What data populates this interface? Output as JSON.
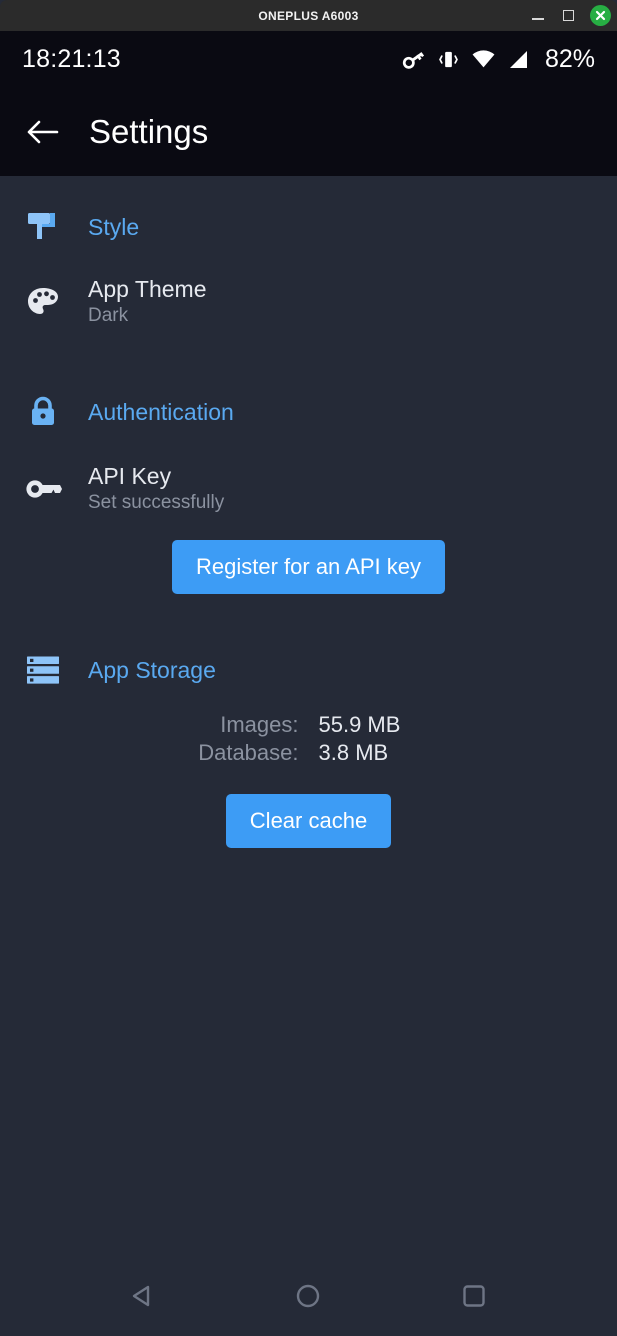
{
  "window": {
    "title": "ONEPLUS A6003",
    "controls": {
      "minimize": "minimize-window",
      "maximize": "maximize-window",
      "close": "close-window"
    }
  },
  "status_bar": {
    "time": "18:21:13",
    "battery": "82%",
    "icons": [
      "vpn-key-icon",
      "vibrate-icon",
      "wifi-icon",
      "cellular-signal-icon"
    ]
  },
  "app_bar": {
    "back_icon": "arrow-left-icon",
    "title": "Settings"
  },
  "sections": [
    {
      "id": "style",
      "icon": "paint-roller-icon",
      "title": "Style",
      "rows": [
        {
          "id": "app-theme",
          "icon": "palette-icon",
          "title": "App Theme",
          "subtitle": "Dark"
        }
      ]
    },
    {
      "id": "authentication",
      "icon": "lock-icon",
      "title": "Authentication",
      "rows": [
        {
          "id": "api-key",
          "icon": "key-icon",
          "title": "API Key",
          "subtitle": "Set successfully"
        }
      ],
      "button": "Register for an API key"
    },
    {
      "id": "app-storage",
      "icon": "storage-icon",
      "title": "App Storage",
      "storage": [
        {
          "label": "Images:",
          "value": "55.9 MB"
        },
        {
          "label": "Database:",
          "value": "3.8 MB"
        }
      ],
      "button": "Clear cache"
    }
  ],
  "nav_bar": {
    "back": "back-triangle-icon",
    "home": "home-circle-icon",
    "recents": "recents-square-icon"
  },
  "colors": {
    "accent": "#3d9cf5",
    "section_header": "#5aa9f0",
    "background": "#252a37",
    "appbar": "#0a0a12",
    "titlebar": "#2b2b2b",
    "close_green": "#27ae43",
    "muted_text": "#8b92a0",
    "primary_text": "#e6e9ef"
  }
}
